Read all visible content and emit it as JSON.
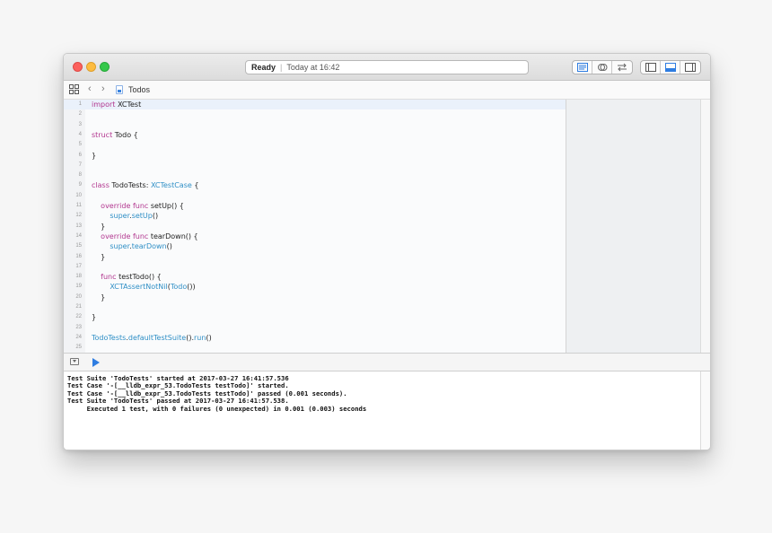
{
  "titlebar": {
    "status_label": "Ready",
    "status_time": "Today at 16:42"
  },
  "toolbar": {
    "editor_icons": [
      "standard-editor-icon",
      "assistant-editor-icon",
      "version-editor-icon"
    ],
    "view_icons": [
      "navigator-toggle-icon",
      "debug-area-toggle-icon",
      "utilities-toggle-icon"
    ]
  },
  "pathbar": {
    "file_name": "Todos"
  },
  "editor": {
    "lines": [
      {
        "n": "1",
        "code": "import XCTest"
      },
      {
        "n": "2",
        "code": ""
      },
      {
        "n": "3",
        "code": ""
      },
      {
        "n": "4",
        "code": "struct Todo {"
      },
      {
        "n": "5",
        "code": ""
      },
      {
        "n": "6",
        "code": "}"
      },
      {
        "n": "7",
        "code": ""
      },
      {
        "n": "8",
        "code": ""
      },
      {
        "n": "9",
        "code": "class TodoTests: XCTestCase {"
      },
      {
        "n": "10",
        "code": ""
      },
      {
        "n": "11",
        "code": "    override func setUp() {"
      },
      {
        "n": "12",
        "code": "        super.setUp()"
      },
      {
        "n": "13",
        "code": "    }"
      },
      {
        "n": "14",
        "code": "    override func tearDown() {"
      },
      {
        "n": "15",
        "code": "        super.tearDown()"
      },
      {
        "n": "16",
        "code": "    }"
      },
      {
        "n": "17",
        "code": ""
      },
      {
        "n": "18",
        "code": "    func testTodo() {"
      },
      {
        "n": "19",
        "code": "        XCTAssertNotNil(Todo())"
      },
      {
        "n": "20",
        "code": "    }"
      },
      {
        "n": "21",
        "code": ""
      },
      {
        "n": "22",
        "code": "}"
      },
      {
        "n": "23",
        "code": ""
      },
      {
        "n": "24",
        "code": "TodoTests.defaultTestSuite().run()"
      },
      {
        "n": "25",
        "code": ""
      }
    ]
  },
  "console": {
    "lines": [
      "Test Suite 'TodoTests' started at 2017-03-27 16:41:57.536",
      "Test Case '-[__lldb_expr_53.TodoTests testTodo]' started.",
      "Test Case '-[__lldb_expr_53.TodoTests testTodo]' passed (0.001 seconds).",
      "Test Suite 'TodoTests' passed at 2017-03-27 16:41:57.538.",
      "     Executed 1 test, with 0 failures (0 unexpected) in 0.001 (0.003) seconds"
    ]
  },
  "colors": {
    "keyword": "#b2368f",
    "type": "#2f8fc6",
    "accent": "#2f7de1"
  }
}
